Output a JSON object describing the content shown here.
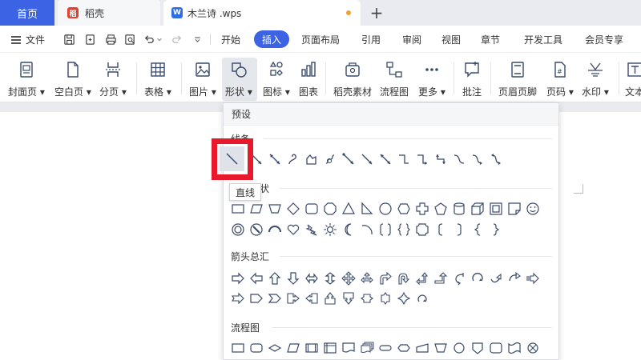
{
  "tabs": {
    "home": "首页",
    "daoke": "稻壳",
    "doc": "木兰诗 .wps",
    "new_tab": "+"
  },
  "menubar": {
    "file": "文件",
    "items": [
      "开始",
      "插入",
      "页面布局",
      "引用",
      "审阅",
      "视图",
      "章节",
      "开发工具",
      "会员专享"
    ],
    "active": "插入"
  },
  "ribbon": {
    "items": [
      "封面页",
      "空白页",
      "分页",
      "表格",
      "图片",
      "形状",
      "图标",
      "图表",
      "稻壳素材",
      "流程图",
      "更多",
      "批注",
      "页眉页脚",
      "页码",
      "水印",
      "文本"
    ]
  },
  "panel": {
    "title": "预设",
    "sections": {
      "lines": "线条",
      "basic": "基本形状",
      "arrows": "箭头总汇",
      "flowchart": "流程图"
    },
    "tooltip": "直线"
  },
  "colors": {
    "accent": "#3b63e4",
    "highlight": "#e8192a",
    "icon_stroke": "#3a4a6a"
  }
}
